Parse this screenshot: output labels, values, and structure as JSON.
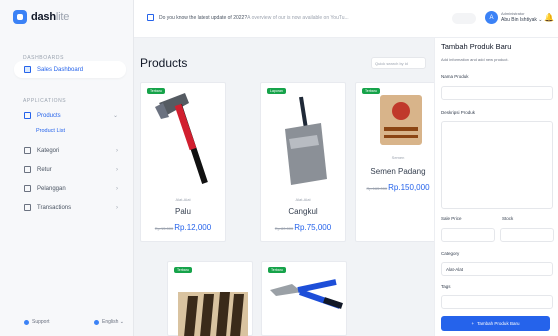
{
  "app": {
    "logo_text": "dash",
    "logo_lite": "lite"
  },
  "sidebar": {
    "sections": {
      "dashboard": "DASHBOARDS",
      "applications": "APPLICATIONS"
    },
    "items": [
      {
        "label": "Sales Dashboard"
      },
      {
        "label": "Products",
        "chevron": "⌄"
      },
      {
        "label": "Kategori",
        "chevron": "›"
      },
      {
        "label": "Retur",
        "chevron": "›"
      },
      {
        "label": "Pelanggan",
        "chevron": "›"
      },
      {
        "label": "Transactions",
        "chevron": "›"
      }
    ],
    "sub_items": [
      {
        "label": "Product List"
      }
    ],
    "footer": {
      "support": "Support",
      "language": "English ⌄"
    }
  },
  "topbar": {
    "notice_main": "Do you know the latest update of 2022? ",
    "notice_muted": "A overview of our is now available on YouTu...",
    "user_role": "Administrator",
    "user_name": "Abu Bin Ishtiyak ⌄",
    "avatar_initial": "A"
  },
  "main": {
    "title": "Products",
    "search_placeholder": "Quick search by id",
    "products": [
      {
        "badge": "Terbaru",
        "category": "Alat-Alat",
        "name": "Palu",
        "old_price": "Rp.15.000",
        "price": "Rp.12,000"
      },
      {
        "badge": "Laporan",
        "category": "Alat-Alat",
        "name": "Cangkul",
        "old_price": "Rp.80.000",
        "price": "Rp.75,000"
      },
      {
        "badge": "Terbaru",
        "category": "Semen",
        "name": "Semen Padang",
        "old_price": "Rp.165.000",
        "price": "Rp.150,000"
      },
      {
        "badge": "Terbaru"
      },
      {
        "badge": "Terbaru"
      }
    ]
  },
  "panel": {
    "title": "Tambah Produk Baru",
    "subtitle": "Add information and add new product.",
    "labels": {
      "name": "Nama Produk",
      "desc": "Deskripsi Produk",
      "sale_price": "Sale Price",
      "stock": "Stock",
      "category": "Category",
      "tags": "Tags"
    },
    "category_value": "Alat-Alat",
    "submit_label": "Tambah Produk Baru",
    "submit_icon": "+"
  },
  "colors": {
    "accent": "#2563eb",
    "badge": "#16a34a"
  }
}
